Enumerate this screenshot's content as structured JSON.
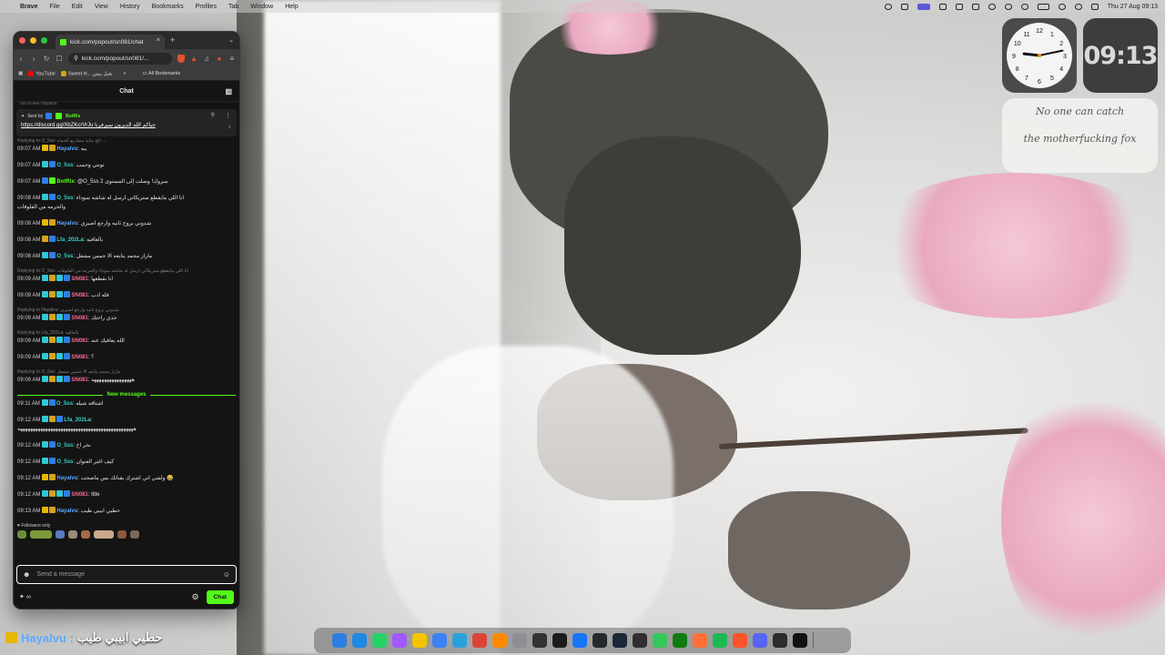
{
  "menubar": {
    "apple": "",
    "items": [
      "Brave",
      "File",
      "Edit",
      "View",
      "History",
      "Bookmarks",
      "Profiles",
      "Tab",
      "Window",
      "Help"
    ],
    "clock": "Thu 27 Aug 09:13",
    "status_icons": [
      "location-icon",
      "bolt-icon",
      "screen-mirror-icon",
      "grid-icon",
      "message-icon",
      "display-icon",
      "moon-icon",
      "brightness-icon",
      "star-icon",
      "battery-icon",
      "wifi-icon",
      "search-icon",
      "control-center-icon"
    ]
  },
  "browser": {
    "tab_title": "kick.com/popout/sn081/chat",
    "url": "kick.com/popout/sn081/...",
    "bookmarks": [
      {
        "label": "YouTube",
        "color": "#ff0000"
      },
      {
        "label": "Sweet H... تعبل بيس",
        "color": "#d8a21a"
      }
    ],
    "all_bookmarks": "All Bookmarks"
  },
  "chat": {
    "header": "Chat",
    "pinned": {
      "sent_by_label": "Sent by",
      "sent_by_user": "BotRix",
      "link": "https://discord.gg/XbZKcrVrJu حياكم الله الديرون سيرفرنا"
    },
    "top_partial": "09:09 AM Hayalvu",
    "messages_before": [
      {
        "reply": "Replying to O_5ss: الخ بداية مشاريع الحماه ...",
        "time": "09:07 AM",
        "badges": [
          "yellow",
          "crown"
        ],
        "user": "Hayalvu",
        "color": "blue",
        "text": "يبه"
      },
      {
        "time": "09:07 AM",
        "badges": [
          "teal",
          "blue"
        ],
        "user": "O_5ss",
        "color": "teal",
        "text": "تونتي وحمت"
      },
      {
        "time": "09:07 AM",
        "badges": [
          "blue",
          "green"
        ],
        "user": "BotRix",
        "color": "green",
        "text": "@O_5ss مبروك! وصلت إلى المستوى 2"
      },
      {
        "time": "09:08 AM",
        "badges": [
          "teal",
          "blue"
        ],
        "user": "O_5ss",
        "color": "teal",
        "text": "انا اللي مايقطع ستريكاتي ارسل له شاشه سوداء",
        "text2": "والحرمه من الفلوقات"
      },
      {
        "time": "09:08 AM",
        "badges": [
          "yellow",
          "crown"
        ],
        "user": "Hayalvu",
        "color": "blue",
        "text": "شدوني بروح ثانيه وارجع اصيري"
      },
      {
        "time": "09:08 AM",
        "badges": [
          "crown",
          "blue"
        ],
        "user": "Lfa_202La",
        "color": "teal",
        "text": "بالعافيه"
      },
      {
        "time": "09:08 AM",
        "badges": [
          "teal",
          "blue"
        ],
        "user": "O_5ss",
        "color": "teal",
        "text": "ماراز محمد بتابعه الا جمس مشعل"
      },
      {
        "reply": "Replying to O_5ss: انا اللي مايقطع ستريكاتي ارسل له شاشه سوداء والحرمه من الفلوقات",
        "time": "09:09 AM",
        "badges": [
          "teal",
          "crown",
          "teal",
          "blue"
        ],
        "user": "SN081",
        "color": "pink",
        "text": "انا نقطعها"
      },
      {
        "time": "09:09 AM",
        "badges": [
          "teal",
          "crown",
          "teal",
          "blue"
        ],
        "user": "SN081",
        "color": "pink",
        "text": "قله ادب"
      },
      {
        "reply": "Replying to Hayalvu: شدوني بروح ثانيه وارجع اصيري",
        "time": "09:09 AM",
        "badges": [
          "teal",
          "crown",
          "teal",
          "blue"
        ],
        "user": "SN081",
        "color": "pink",
        "text": "خذي راحتك"
      },
      {
        "reply": "Replying to Lfa_202La: بالعافيه",
        "time": "09:09 AM",
        "badges": [
          "teal",
          "crown",
          "teal",
          "blue"
        ],
        "user": "SN081",
        "color": "pink",
        "text": "الله يعافيك عنه"
      },
      {
        "time": "09:09 AM",
        "badges": [
          "teal",
          "crown",
          "teal",
          "blue"
        ],
        "user": "SN081",
        "color": "pink",
        "text": "؟"
      },
      {
        "reply": "Replying to O_5ss: ماراز محمد بتابعه الا جمس مشعل",
        "time": "09:09 AM",
        "badges": [
          "teal",
          "crown",
          "teal",
          "blue"
        ],
        "user": "SN081",
        "color": "pink",
        "text": "ههههههههههههههههه"
      }
    ],
    "new_messages_label": "New messages",
    "messages_after": [
      {
        "time": "09:11 AM",
        "badges": [
          "teal",
          "blue"
        ],
        "user": "O_5ss",
        "color": "teal",
        "text": "اشتاقه شيله"
      },
      {
        "time": "09:12 AM",
        "badges": [
          "teal",
          "crown",
          "blue"
        ],
        "user": "Lfa_202La",
        "color": "teal",
        "text": "",
        "text2": "ههههههههههههههههههههههههههههههههههههههههههههههه"
      },
      {
        "time": "09:12 AM",
        "badges": [
          "teal",
          "blue"
        ],
        "user": "O_5ss",
        "color": "teal",
        "text": "نخر اخ"
      },
      {
        "time": "09:12 AM",
        "badges": [
          "teal",
          "blue"
        ],
        "user": "O_5ss",
        "color": "teal",
        "text": "كيف اغير العنوان"
      },
      {
        "time": "09:12 AM",
        "badges": [
          "yellow",
          "crown"
        ],
        "user": "Hayalvu",
        "color": "blue",
        "text": "ولشي اني اشترك بقناتك بس ماصحت 😂"
      },
      {
        "time": "09:12 AM",
        "badges": [
          "teal",
          "crown",
          "teal",
          "blue"
        ],
        "user": "SN081",
        "color": "pink",
        "text": "title"
      },
      {
        "time": "09:13 AM",
        "badges": [
          "yellow",
          "crown"
        ],
        "user": "Hayalvu",
        "color": "blue",
        "text": "حطيي ابيبي طيب"
      }
    ],
    "followers_only": "Followers only",
    "input_placeholder": "Send a message",
    "points": "∞",
    "chat_button": "Chat"
  },
  "widgets": {
    "analog_clock": {
      "hour": 9,
      "minute": 13,
      "numerals": [
        "12",
        "1",
        "2",
        "3",
        "4",
        "5",
        "6",
        "7",
        "8",
        "9",
        "10",
        "11"
      ]
    },
    "digital_clock": "09:13",
    "note_lines": [
      "No one can catch",
      "the motherfucking fox"
    ]
  },
  "overlay": {
    "user": "Hayalvu :",
    "text": "حطيي ابيبي طيب"
  },
  "dock": {
    "apps": [
      {
        "name": "finder-icon",
        "color": "#2f7de1"
      },
      {
        "name": "safari-icon",
        "color": "#1e88e5"
      },
      {
        "name": "whatsapp-icon",
        "color": "#25d366"
      },
      {
        "name": "figma-icon",
        "color": "#a259ff"
      },
      {
        "name": "notes-icon",
        "color": "#f5c400"
      },
      {
        "name": "mail-icon",
        "color": "#3b82f6"
      },
      {
        "name": "telegram-icon",
        "color": "#2aa1de"
      },
      {
        "name": "chrome-icon",
        "color": "#db4437"
      },
      {
        "name": "pen-icon",
        "color": "#ff8a00"
      },
      {
        "name": "settings-icon",
        "color": "#8e8e93"
      },
      {
        "name": "calculator-icon",
        "color": "#333333"
      },
      {
        "name": "terminal-icon",
        "color": "#1c1c1c"
      },
      {
        "name": "xcode-icon",
        "color": "#1575f9"
      },
      {
        "name": "github-icon",
        "color": "#24292e"
      },
      {
        "name": "steam-icon",
        "color": "#1b2838"
      },
      {
        "name": "obs-icon",
        "color": "#302e31"
      },
      {
        "name": "messages-icon",
        "color": "#34c759"
      },
      {
        "name": "xbox-icon",
        "color": "#107c10"
      },
      {
        "name": "firefox-icon",
        "color": "#ff7139"
      },
      {
        "name": "spotify-icon",
        "color": "#1db954"
      },
      {
        "name": "brave-icon",
        "color": "#fb542b"
      },
      {
        "name": "discord-icon",
        "color": "#5865f2"
      },
      {
        "name": "audio-icon",
        "color": "#2c2c2c"
      },
      {
        "name": "obs-studio-icon",
        "color": "#111111"
      },
      {
        "name": "trash-icon",
        "color": "#9e9e9e"
      }
    ]
  },
  "colors": {
    "kick_green": "#53fc18",
    "chat_bg": "#141414"
  }
}
